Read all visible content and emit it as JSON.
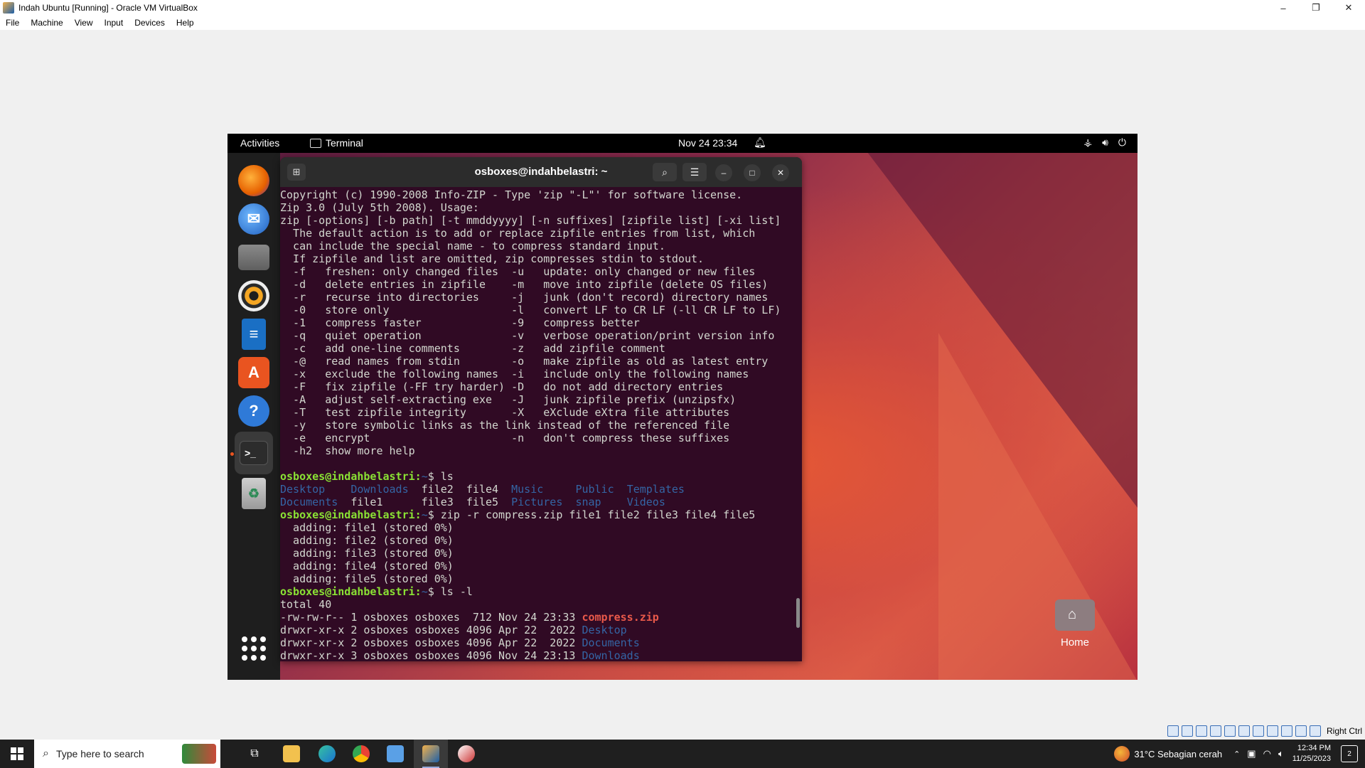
{
  "host": {
    "title": "Indah Ubuntu [Running] - Oracle VM VirtualBox",
    "menu": [
      "File",
      "Machine",
      "View",
      "Input",
      "Devices",
      "Help"
    ],
    "window_controls": [
      "–",
      "❐",
      "✕"
    ],
    "host_key": "Right Ctrl"
  },
  "guest": {
    "topbar": {
      "activities": "Activities",
      "app_name": "Terminal",
      "clock": "Nov 24  23:34"
    },
    "terminal": {
      "title": "osboxes@indahbelastri: ~",
      "lines": [
        [
          {
            "t": "Copyright (c) 1990-2008 Info-ZIP - Type 'zip \"-L\"' for software license."
          }
        ],
        [
          {
            "t": "Zip 3.0 (July 5th 2008). Usage:"
          }
        ],
        [
          {
            "t": "zip [-options] [-b path] [-t mmddyyyy] [-n suffixes] [zipfile list] [-xi list]"
          }
        ],
        [
          {
            "t": "  The default action is to add or replace zipfile entries from list, which"
          }
        ],
        [
          {
            "t": "  can include the special name - to compress standard input."
          }
        ],
        [
          {
            "t": "  If zipfile and list are omitted, zip compresses stdin to stdout."
          }
        ],
        [
          {
            "t": "  -f   freshen: only changed files  -u   update: only changed or new files"
          }
        ],
        [
          {
            "t": "  -d   delete entries in zipfile    -m   move into zipfile (delete OS files)"
          }
        ],
        [
          {
            "t": "  -r   recurse into directories     -j   junk (don't record) directory names"
          }
        ],
        [
          {
            "t": "  -0   store only                   -l   convert LF to CR LF (-ll CR LF to LF)"
          }
        ],
        [
          {
            "t": "  -1   compress faster              -9   compress better"
          }
        ],
        [
          {
            "t": "  -q   quiet operation              -v   verbose operation/print version info"
          }
        ],
        [
          {
            "t": "  -c   add one-line comments        -z   add zipfile comment"
          }
        ],
        [
          {
            "t": "  -@   read names from stdin        -o   make zipfile as old as latest entry"
          }
        ],
        [
          {
            "t": "  -x   exclude the following names  -i   include only the following names"
          }
        ],
        [
          {
            "t": "  -F   fix zipfile (-FF try harder) -D   do not add directory entries"
          }
        ],
        [
          {
            "t": "  -A   adjust self-extracting exe   -J   junk zipfile prefix (unzipsfx)"
          }
        ],
        [
          {
            "t": "  -T   test zipfile integrity       -X   eXclude eXtra file attributes"
          }
        ],
        [
          {
            "t": "  -y   store symbolic links as the link instead of the referenced file"
          }
        ],
        [
          {
            "t": "  -e   encrypt                      -n   don't compress these suffixes"
          }
        ],
        [
          {
            "t": "  -h2  show more help"
          }
        ],
        [
          {
            "t": ""
          }
        ],
        [
          {
            "t": "osboxes@indahbelastri:",
            "c": "prompt"
          },
          {
            "t": "~",
            "c": "blue"
          },
          {
            "t": "$ ls"
          }
        ],
        [
          {
            "t": "Desktop",
            "c": "blue"
          },
          {
            "t": "    "
          },
          {
            "t": "Downloads",
            "c": "blue"
          },
          {
            "t": "  file2  file4  "
          },
          {
            "t": "Music",
            "c": "blue"
          },
          {
            "t": "     "
          },
          {
            "t": "Public",
            "c": "blue"
          },
          {
            "t": "  "
          },
          {
            "t": "Templates",
            "c": "blue"
          }
        ],
        [
          {
            "t": "Documents",
            "c": "blue"
          },
          {
            "t": "  file1      file3  file5  "
          },
          {
            "t": "Pictures",
            "c": "blue"
          },
          {
            "t": "  "
          },
          {
            "t": "snap",
            "c": "blue"
          },
          {
            "t": "    "
          },
          {
            "t": "Videos",
            "c": "blue"
          }
        ],
        [
          {
            "t": "osboxes@indahbelastri:",
            "c": "prompt"
          },
          {
            "t": "~",
            "c": "blue"
          },
          {
            "t": "$ zip -r compress.zip file1 file2 file3 file4 file5"
          }
        ],
        [
          {
            "t": "  adding: file1 (stored 0%)"
          }
        ],
        [
          {
            "t": "  adding: file2 (stored 0%)"
          }
        ],
        [
          {
            "t": "  adding: file3 (stored 0%)"
          }
        ],
        [
          {
            "t": "  adding: file4 (stored 0%)"
          }
        ],
        [
          {
            "t": "  adding: file5 (stored 0%)"
          }
        ],
        [
          {
            "t": "osboxes@indahbelastri:",
            "c": "prompt"
          },
          {
            "t": "~",
            "c": "blue"
          },
          {
            "t": "$ ls -l"
          }
        ],
        [
          {
            "t": "total 40"
          }
        ],
        [
          {
            "t": "-rw-rw-r-- 1 osboxes osboxes  712 Nov 24 23:33 "
          },
          {
            "t": "compress.zip",
            "c": "red"
          }
        ],
        [
          {
            "t": "drwxr-xr-x 2 osboxes osboxes 4096 Apr 22  2022 "
          },
          {
            "t": "Desktop",
            "c": "blue"
          }
        ],
        [
          {
            "t": "drwxr-xr-x 2 osboxes osboxes 4096 Apr 22  2022 "
          },
          {
            "t": "Documents",
            "c": "blue"
          }
        ],
        [
          {
            "t": "drwxr-xr-x 3 osboxes osboxes 4096 Nov 24 23:13 "
          },
          {
            "t": "Downloads",
            "c": "blue"
          }
        ]
      ]
    },
    "desktop_icon": {
      "label": "Home"
    }
  },
  "taskbar": {
    "search_placeholder": "Type here to search",
    "weather": "31°C  Sebagian cerah",
    "time": "12:34 PM",
    "date": "11/25/2023",
    "notifications": "2"
  },
  "colors": {
    "terminal_bg": "#300a24",
    "prompt_green": "#8ae234",
    "dir_blue": "#3465a4",
    "archive_red": "#e9594a",
    "ubuntu_orange": "#e95420"
  }
}
